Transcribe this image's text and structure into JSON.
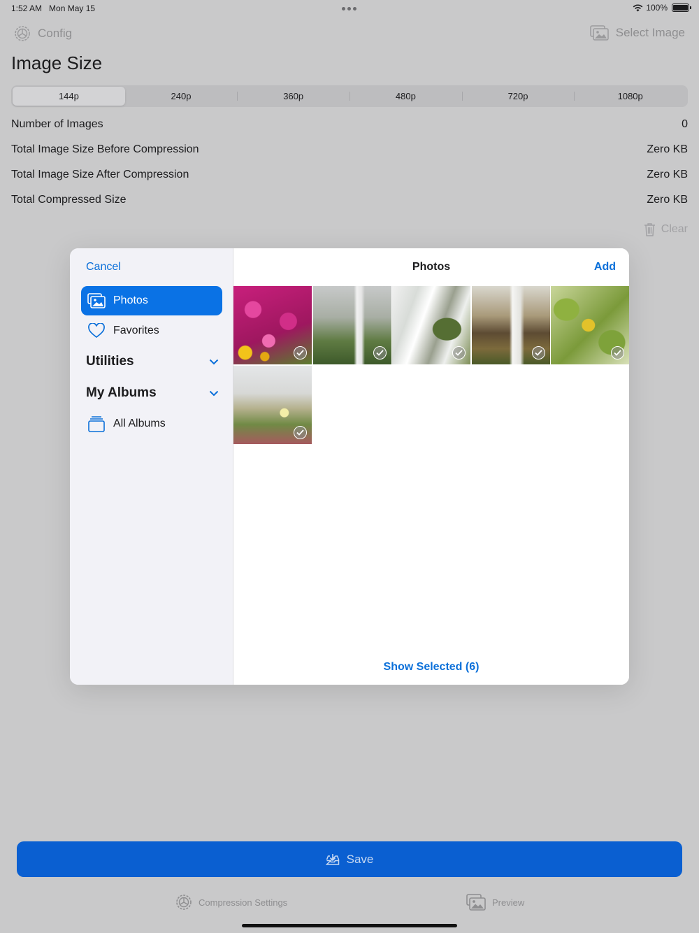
{
  "status_bar": {
    "time": "1:52 AM",
    "date": "Mon May 15",
    "battery": "100%"
  },
  "nav": {
    "config_label": "Config",
    "select_image_label": "Select Image"
  },
  "page_title": "Image Size",
  "sizes": [
    "144p",
    "240p",
    "360p",
    "480p",
    "720p",
    "1080p"
  ],
  "selected_size": "144p",
  "stats": [
    {
      "label": "Number of Images",
      "value": "0"
    },
    {
      "label": "Total Image Size Before Compression",
      "value": "Zero KB"
    },
    {
      "label": "Total Image Size After Compression",
      "value": "Zero KB"
    },
    {
      "label": "Total Compressed Size",
      "value": "Zero KB"
    }
  ],
  "clear_label": "Clear",
  "picker": {
    "cancel_label": "Cancel",
    "title": "Photos",
    "add_label": "Add",
    "sidebar": {
      "photos_label": "Photos",
      "favorites_label": "Favorites",
      "utilities_label": "Utilities",
      "my_albums_label": "My Albums",
      "all_albums_label": "All Albums"
    },
    "photo_count": 6,
    "show_selected_label": "Show Selected (6)"
  },
  "save_label": "Save",
  "tabs": {
    "compression_settings_label": "Compression Settings",
    "preview_label": "Preview"
  },
  "colors": {
    "accent": "#0a6fd9",
    "save_button": "#0a5fd1",
    "background": "#c9c9ca"
  }
}
